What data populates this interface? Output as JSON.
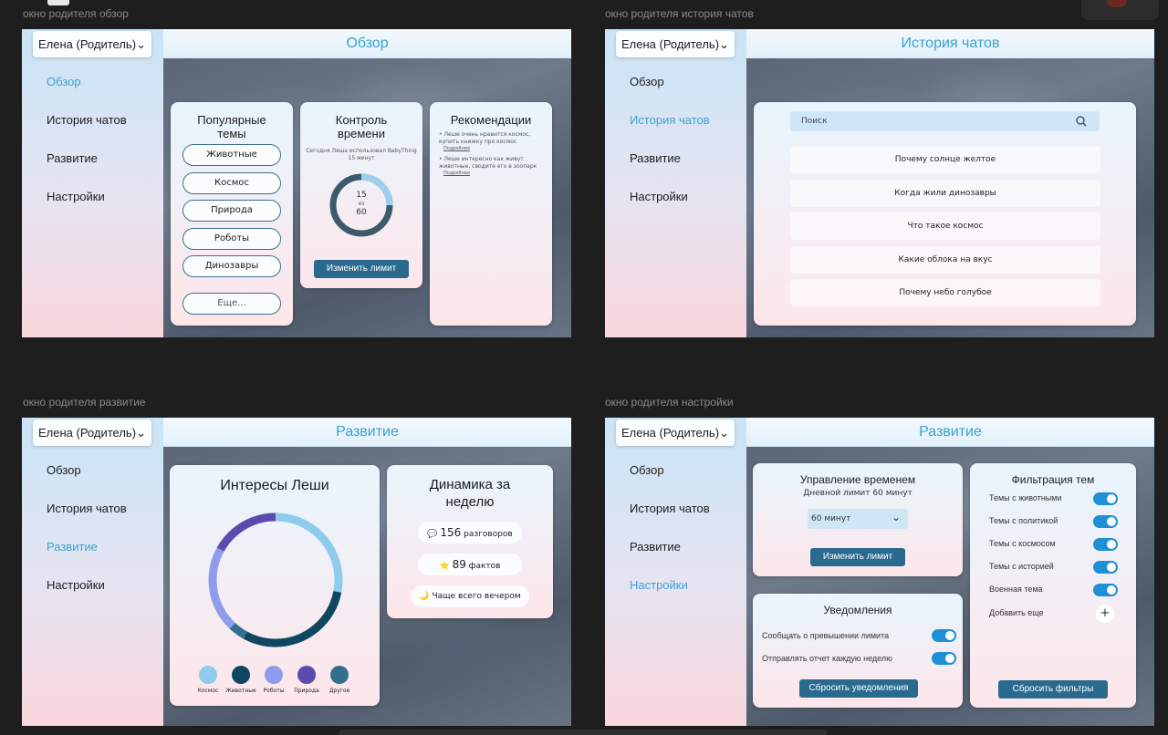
{
  "labels": {
    "overview": "окно родителя обзор",
    "history": "окно родителя история чатов",
    "dev": "окно родителя развитие",
    "settings": "окно родителя настройки"
  },
  "user": "Елена (Родитель)",
  "nav": [
    "Обзор",
    "История чатов",
    "Развитие",
    "Настройки"
  ],
  "overview": {
    "title": "Обзор",
    "topics_title": "Популярные темы",
    "topics": [
      "Животные",
      "Космос",
      "Природа",
      "Роботы",
      "Динозавры"
    ],
    "more": "Еще...",
    "time_title": "Контроль времени",
    "time_text": "Сегодня Леша использовал BabyThing 15 минут",
    "time_used": 15,
    "time_of": "из",
    "time_limit": 60,
    "time_button": "Изменить лимит",
    "rec_title": "Рекомендации",
    "recs": [
      {
        "text": "Леше очень нравится космос, купить книжку про космос",
        "link": "Подробнее"
      },
      {
        "text": "Леше интересно как живут животные, сводите его в зоопарк",
        "link": "Подробнее"
      }
    ]
  },
  "history": {
    "title": "История чатов",
    "search_placeholder": "Поиск",
    "items": [
      "Почему солнце желтое",
      "Когда жили динозавры",
      "Что такое космос",
      "Какие облока на вкус",
      "Почему небо голубое"
    ]
  },
  "dev": {
    "title": "Развитие",
    "interests_title": "Интересы Леши",
    "legend": [
      {
        "label": "Космос",
        "color": "#8fcbed"
      },
      {
        "label": "Животные",
        "color": "#0f4662"
      },
      {
        "label": "Роботы",
        "color": "#8e9ceb"
      },
      {
        "label": "Природа",
        "color": "#5b4bae"
      },
      {
        "label": "Другое",
        "color": "#336f8f"
      }
    ],
    "dyn_title": "Динамика за неделю",
    "talks_num": "156",
    "talks_label": "разговоров",
    "facts_num": "89",
    "facts_label": "фактов",
    "evening": "Чаще всего вечером"
  },
  "settings": {
    "title": "Развитие",
    "time_title": "Управление временем",
    "daily": "Дневной лимит 60 минут",
    "select_value": "60 минут",
    "change_button": "Изменить лимит",
    "notif_title": "Уведомления",
    "notif": [
      {
        "label": "Сообщать о превышении лимита",
        "on": true
      },
      {
        "label": "Отправлять отчет каждую неделю",
        "on": false
      }
    ],
    "notif_button": "Сбросить уведомления",
    "filter_title": "Фильтрация тем",
    "filters": [
      {
        "label": "Темы с животными",
        "on": true
      },
      {
        "label": "Темы с политикой",
        "on": false
      },
      {
        "label": "Темы с космосом",
        "on": true
      },
      {
        "label": "Темы с историей",
        "on": true
      },
      {
        "label": "Военная тема",
        "on": false
      }
    ],
    "add_more": "Добавить еще",
    "filter_button": "Сбросить фильтры"
  },
  "donut": {
    "segments": [
      {
        "color": "#8fcbed",
        "value": 28
      },
      {
        "color": "#0f4662",
        "value": 30
      },
      {
        "color": "#336f8f",
        "value": 4
      },
      {
        "color": "#8e9ceb",
        "value": 21
      },
      {
        "color": "#5b4bae",
        "value": 17
      }
    ]
  }
}
